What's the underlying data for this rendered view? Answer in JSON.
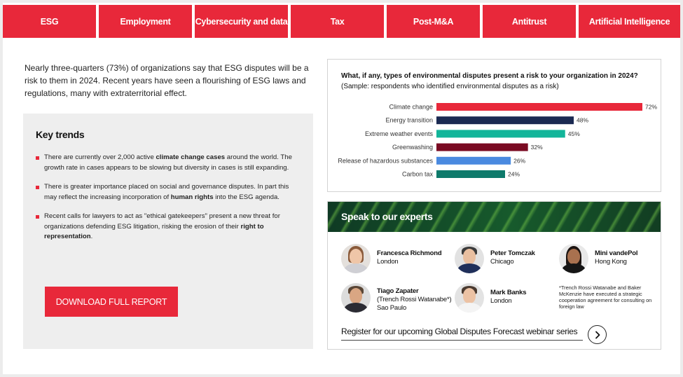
{
  "tabs": [
    {
      "label": "ESG"
    },
    {
      "label": "Employment"
    },
    {
      "label": "Cybersecurity and data"
    },
    {
      "label": "Tax"
    },
    {
      "label": "Post-M&A"
    },
    {
      "label": "Antitrust"
    },
    {
      "label": "Artificial Intelligence"
    }
  ],
  "intro": "Nearly three-quarters (73%) of organizations say that ESG disputes will be a risk to them in 2024. Recent years have seen a flourishing of ESG laws and regulations, many with extraterritorial effect.",
  "trends": {
    "title": "Key trends",
    "items": [
      {
        "pre": "There are currently over 2,000 active ",
        "bold": "climate change cases",
        "post": " around the world. The growth rate in cases appears to be slowing but diversity in cases is still expanding."
      },
      {
        "pre": "There is greater importance placed on social and governance disputes. In part this may reflect the increasing incorporation of ",
        "bold": "human rights",
        "post": " into the ESG agenda."
      },
      {
        "pre": "Recent calls for lawyers to act as \"ethical gatekeepers\" present a new threat for organizations defending ESG litigation, risking the erosion of their ",
        "bold": "right to representation",
        "post": "."
      }
    ],
    "download_label": "DOWNLOAD FULL REPORT"
  },
  "chart": {
    "question_bold": "What, if any, types of environmental disputes present a risk to your organization in 2024?",
    "question_rest": " (Sample: respondents who identified environmental disputes as a risk)"
  },
  "chart_data": {
    "type": "bar",
    "orientation": "horizontal",
    "categories": [
      "Climate change",
      "Energy transition",
      "Extreme weather events",
      "Greenwashing",
      "Release of hazardous substances",
      "Carbon tax"
    ],
    "values": [
      72,
      48,
      45,
      32,
      26,
      24
    ],
    "value_labels": [
      "72%",
      "48%",
      "45%",
      "32%",
      "26%",
      "24%"
    ],
    "colors": [
      "#e8283a",
      "#1b2a52",
      "#13b59a",
      "#7a0a22",
      "#4a8ae0",
      "#0e7a6b"
    ],
    "xlim": [
      0,
      72
    ],
    "grid": false,
    "legend": "none"
  },
  "experts": {
    "title": "Speak to our experts",
    "people": [
      {
        "name": "Francesca Richmond",
        "location": "London"
      },
      {
        "name": "Peter Tomczak",
        "location": "Chicago"
      },
      {
        "name": "Mini vandePol",
        "location": "Hong Kong"
      },
      {
        "name": "Tiago Zapater",
        "firm": "(Trench Rossi Watanabe*)",
        "location": "Sao Paulo"
      },
      {
        "name": "Mark Banks",
        "location": "London"
      }
    ],
    "note": "*Trench Rossi Watanabe and Baker McKenzie have executed a strategic cooperation agreement for consulting on foreign law",
    "register_label": "Register for our upcoming Global Disputes Forecast webinar series",
    "register_icon": "chevron-right-icon"
  }
}
